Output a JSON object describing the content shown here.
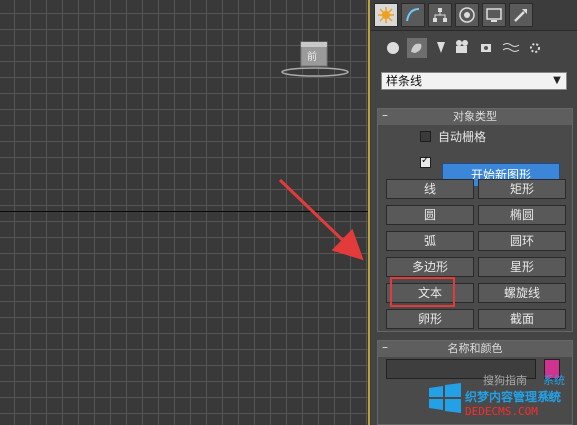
{
  "viewport": {
    "viewcube_label": "前"
  },
  "panel": {
    "category_select": "样条线",
    "object_type": {
      "title": "对象类型",
      "autogrid_label": "自动栅格",
      "start_new_shape_label": "开始新图形",
      "buttons": [
        "线",
        "矩形",
        "圆",
        "椭圆",
        "弧",
        "圆环",
        "多边形",
        "星形",
        "文本",
        "螺旋线",
        "卵形",
        "截面"
      ]
    },
    "name_color": {
      "title": "名称和颜色"
    }
  },
  "colors": {
    "accent_button": "#3b86d8",
    "highlight_box": "#e33b3b",
    "object_color": "#d0338f"
  },
  "watermark": {
    "line1": "搜狗指南",
    "line2": "系统粉",
    "line3": "DEDECMS.COM",
    "line2b": "织梦内容管理系统"
  }
}
